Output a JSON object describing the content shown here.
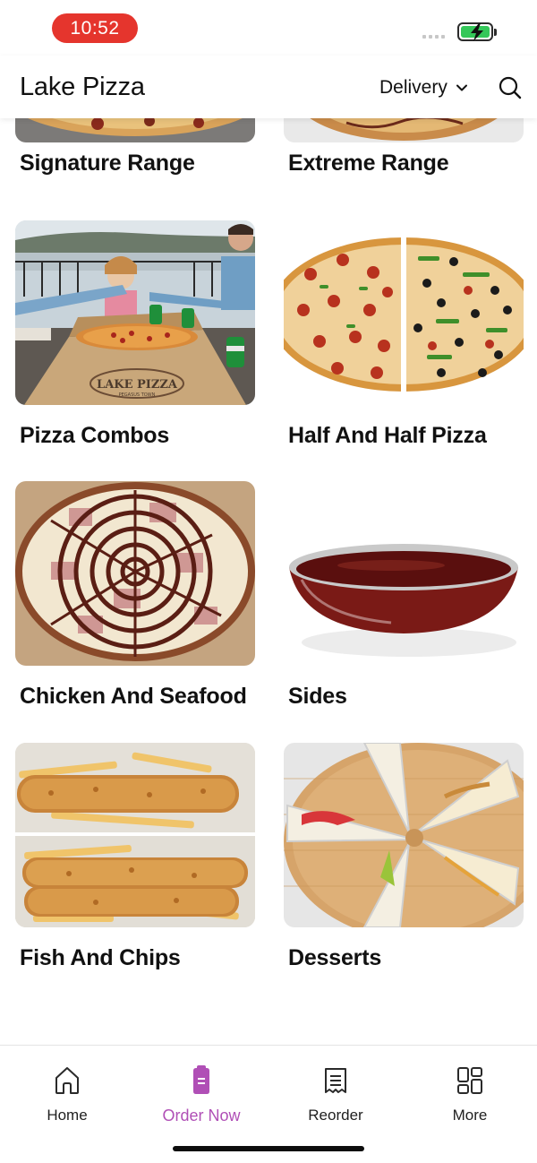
{
  "status_bar": {
    "time": "10:52"
  },
  "header": {
    "title": "Lake Pizza",
    "order_mode": "Delivery"
  },
  "categories": [
    {
      "label": "Signature Range"
    },
    {
      "label": "Extreme Range"
    },
    {
      "label": "Pizza Combos"
    },
    {
      "label": "Half And Half Pizza"
    },
    {
      "label": "Chicken And Seafood"
    },
    {
      "label": "Sides"
    },
    {
      "label": "Fish And Chips"
    },
    {
      "label": "Desserts"
    }
  ],
  "photo_text": {
    "box_brand": "LAKE PIZZA",
    "box_sub": "PEGASUS TOWN"
  },
  "bottom_nav": {
    "items": [
      {
        "label": "Home",
        "icon": "home-icon"
      },
      {
        "label": "Order Now",
        "icon": "order-icon",
        "active": true
      },
      {
        "label": "Reorder",
        "icon": "receipt-icon"
      },
      {
        "label": "More",
        "icon": "grid-icon"
      }
    ]
  },
  "colors": {
    "accent": "#b04fb6",
    "time_pill": "#e5352d",
    "battery": "#34c759"
  }
}
